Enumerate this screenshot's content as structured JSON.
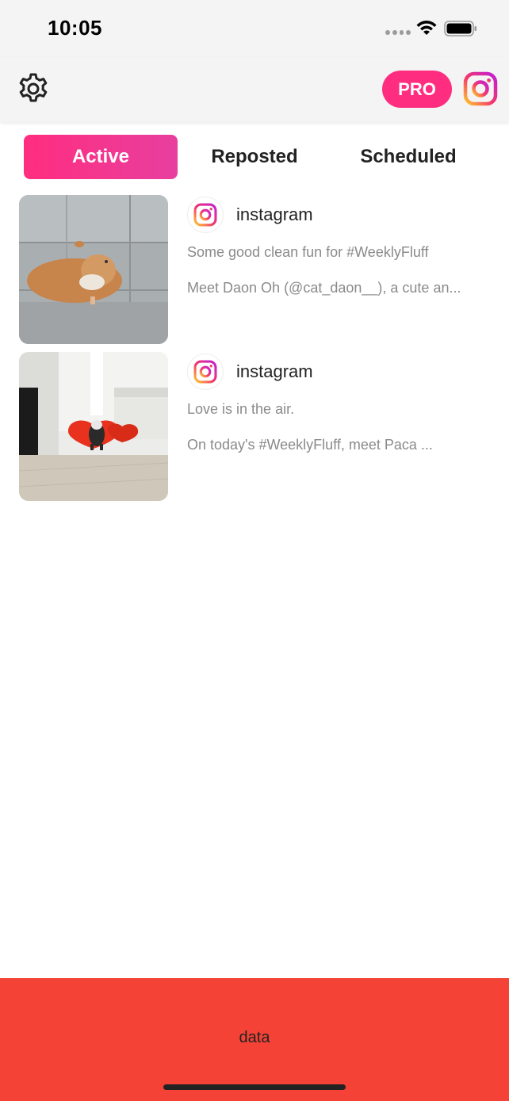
{
  "status_bar": {
    "time": "10:05"
  },
  "header": {
    "pro_label": "PRO"
  },
  "tabs": [
    {
      "label": "Active",
      "active": true
    },
    {
      "label": "Reposted",
      "active": false
    },
    {
      "label": "Scheduled",
      "active": false
    }
  ],
  "posts": [
    {
      "user": "instagram",
      "caption": "Some good clean fun for #WeeklyFluff",
      "description": "Meet Daon Oh (@cat_daon__), a cute an...",
      "thumbnail": "hamster-bath-photo"
    },
    {
      "user": "instagram",
      "caption": "Love is in the air.",
      "description": "On today's #WeeklyFluff, meet Paca ...",
      "thumbnail": "dog-heart-pillow-photo"
    }
  ],
  "banner": {
    "text": "data"
  },
  "colors": {
    "accent": "#ff2d7f",
    "banner": "#f44336",
    "header_bg": "#f4f4f4"
  }
}
